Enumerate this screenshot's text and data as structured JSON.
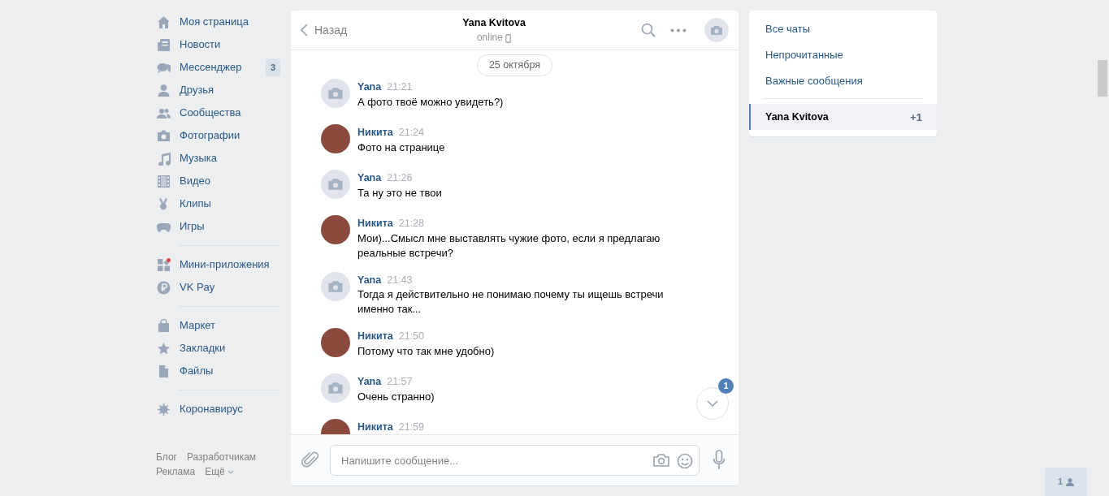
{
  "nav_sections": [
    [
      {
        "label": "Моя страница"
      },
      {
        "label": "Новости"
      },
      {
        "label": "Мессенджер",
        "badge": "3"
      },
      {
        "label": "Друзья"
      },
      {
        "label": "Сообщества"
      },
      {
        "label": "Фотографии"
      },
      {
        "label": "Музыка"
      },
      {
        "label": "Видео"
      },
      {
        "label": "Клипы"
      },
      {
        "label": "Игры"
      }
    ],
    [
      {
        "label": "Мини-приложения"
      },
      {
        "label": "VK Pay"
      }
    ],
    [
      {
        "label": "Маркет"
      },
      {
        "label": "Закладки"
      },
      {
        "label": "Файлы"
      }
    ],
    [
      {
        "label": "Коронавирус"
      }
    ]
  ],
  "footer_links": [
    [
      "Блог",
      "Разработчикам"
    ],
    [
      "Реклама",
      "Ещё"
    ]
  ],
  "chat": {
    "back": "Назад",
    "title": "Yana Kvitova",
    "status": "online",
    "date": "25 октября",
    "messages": [
      {
        "kind": "placeholder",
        "author": "Yana",
        "time": "21:21",
        "text": "А фото твоё можно увидеть?)"
      },
      {
        "kind": "photo",
        "author": "Никита",
        "time": "21:24",
        "text": "Фото на странице"
      },
      {
        "kind": "placeholder",
        "author": "Yana",
        "time": "21:26",
        "text": "Та ну это не твои"
      },
      {
        "kind": "photo",
        "author": "Никита",
        "time": "21:28",
        "text": "Мои)...Смысл мне выставлять чужие фото, если я предлагаю реальные встречи?"
      },
      {
        "kind": "placeholder",
        "author": "Yana",
        "time": "21:43",
        "text": "Тогда я действительно не понимаю почему ты ищешь встречи именно так..."
      },
      {
        "kind": "photo",
        "author": "Никита",
        "time": "21:50",
        "text": "Потому что так мне удобно)"
      },
      {
        "kind": "placeholder",
        "author": "Yana",
        "time": "21:57",
        "text": "Очень странно)"
      },
      {
        "kind": "photo",
        "author": "Никита",
        "time": "21:59"
      }
    ],
    "unread_badge": "1",
    "input": {
      "placeholder": "Напишите сообщение..."
    }
  },
  "filters": [
    {
      "label": "Все чаты"
    },
    {
      "label": "Непрочитанные"
    },
    {
      "label": "Важные сообщения"
    }
  ],
  "chats": [
    {
      "name": "Yana Kvitova",
      "count": "+1",
      "selected": true
    }
  ],
  "friends_online": "1"
}
